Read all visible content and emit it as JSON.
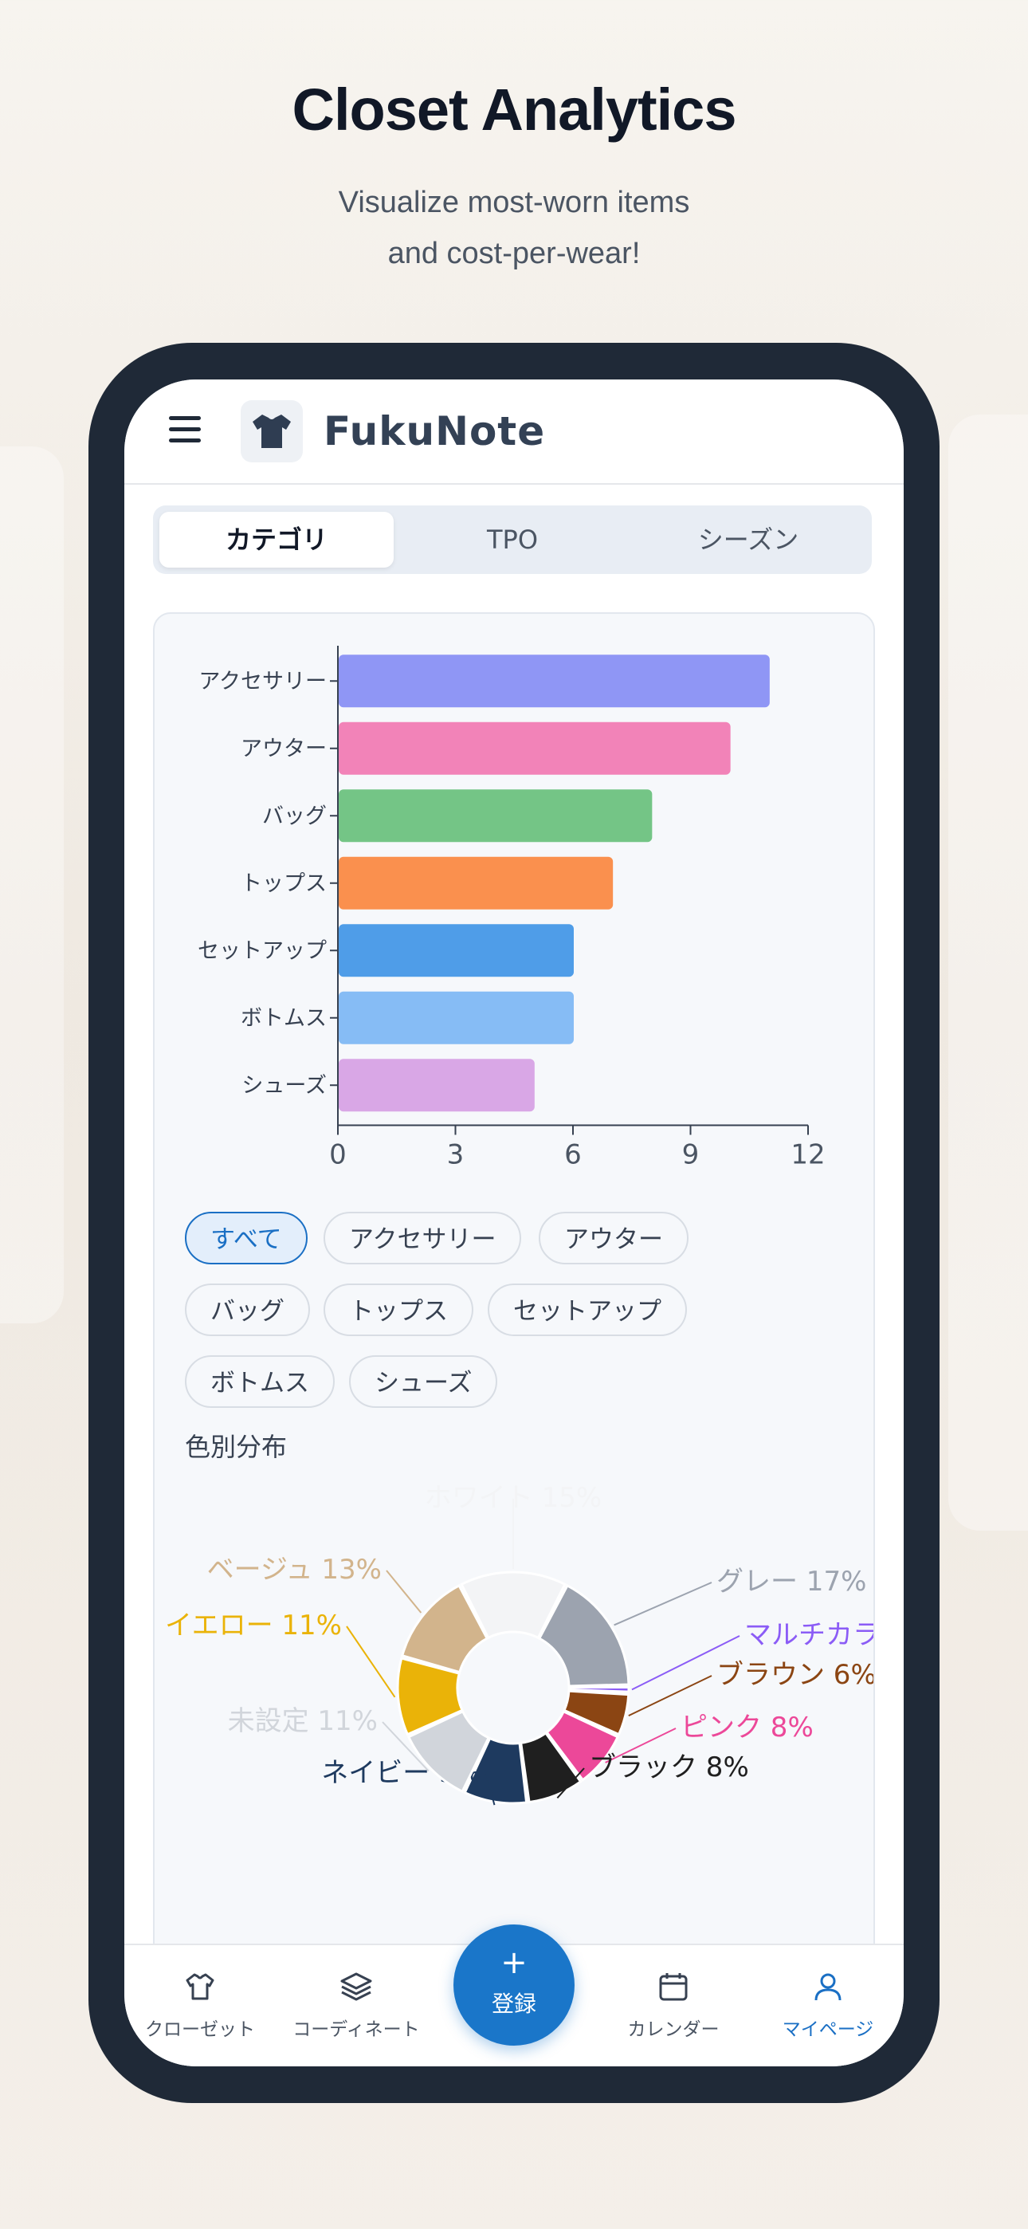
{
  "promo": {
    "headline": "Closet Analytics",
    "sub_line1": "Visualize most-worn items",
    "sub_line2": "and cost-per-wear!"
  },
  "app": {
    "name": "FukuNote"
  },
  "tabs": [
    {
      "label": "カテゴリ",
      "active": true
    },
    {
      "label": "TPO",
      "active": false
    },
    {
      "label": "シーズン",
      "active": false
    }
  ],
  "chart_data": [
    {
      "type": "bar",
      "orientation": "horizontal",
      "categories": [
        "アクセサリー",
        "アウター",
        "バッグ",
        "トップス",
        "セットアップ",
        "ボトムス",
        "シューズ"
      ],
      "values": [
        11,
        10,
        8,
        7,
        6,
        6,
        5
      ],
      "colors": [
        "#8f96f5",
        "#f283b8",
        "#74c586",
        "#fa904e",
        "#4f9de8",
        "#86bcf5",
        "#d9a7e6"
      ],
      "xlim": [
        0,
        12
      ],
      "xticks": [
        0,
        3,
        6,
        9,
        12
      ],
      "grid": false,
      "title": ""
    },
    {
      "type": "pie",
      "variant": "donut",
      "slices": [
        {
          "label": "ホワイト",
          "percent": 15,
          "text": "ホワイト 15%",
          "color": "#f3f4f6"
        },
        {
          "label": "グレー",
          "percent": 17,
          "text": "グレー 17%",
          "color": "#9ca3af"
        },
        {
          "label": "マルチカラー",
          "percent": 1,
          "text": "マルチカラー",
          "color": "#8b5cf6"
        },
        {
          "label": "ブラウン",
          "percent": 6,
          "text": "ブラウン 6%",
          "color": "#8b4513"
        },
        {
          "label": "ピンク",
          "percent": 8,
          "text": "ピンク 8%",
          "color": "#ec4899"
        },
        {
          "label": "ブラック",
          "percent": 8,
          "text": "ブラック 8%",
          "color": "#1f1f1f"
        },
        {
          "label": "ネイビー",
          "percent": 9,
          "text": "ネイビー 9%",
          "color": "#1e3a5f"
        },
        {
          "label": "未設定",
          "percent": 11,
          "text": "未設定 11%",
          "color": "#d1d5db"
        },
        {
          "label": "イエロー",
          "percent": 11,
          "text": "イエロー 11%",
          "color": "#eab308"
        },
        {
          "label": "ベージュ",
          "percent": 13,
          "text": "ベージュ 13%",
          "color": "#d2b48c"
        }
      ]
    }
  ],
  "filters": {
    "chips": [
      "すべて",
      "アクセサリー",
      "アウター",
      "バッグ",
      "トップス",
      "セットアップ",
      "ボトムス",
      "シューズ"
    ],
    "active": "すべて"
  },
  "color_section": {
    "title": "色別分布"
  },
  "bottom_nav": {
    "items": [
      {
        "label": "クローゼット",
        "icon": "shirt-icon",
        "active": false
      },
      {
        "label": "コーディネート",
        "icon": "layers-icon",
        "active": false
      },
      {
        "label": "カレンダー",
        "icon": "calendar-icon",
        "active": false
      },
      {
        "label": "マイページ",
        "icon": "user-icon",
        "active": true
      }
    ],
    "fab": {
      "plus": "+",
      "label": "登録"
    }
  },
  "colors": {
    "accent": "#1a76c9",
    "phone_frame": "#1f2937"
  }
}
